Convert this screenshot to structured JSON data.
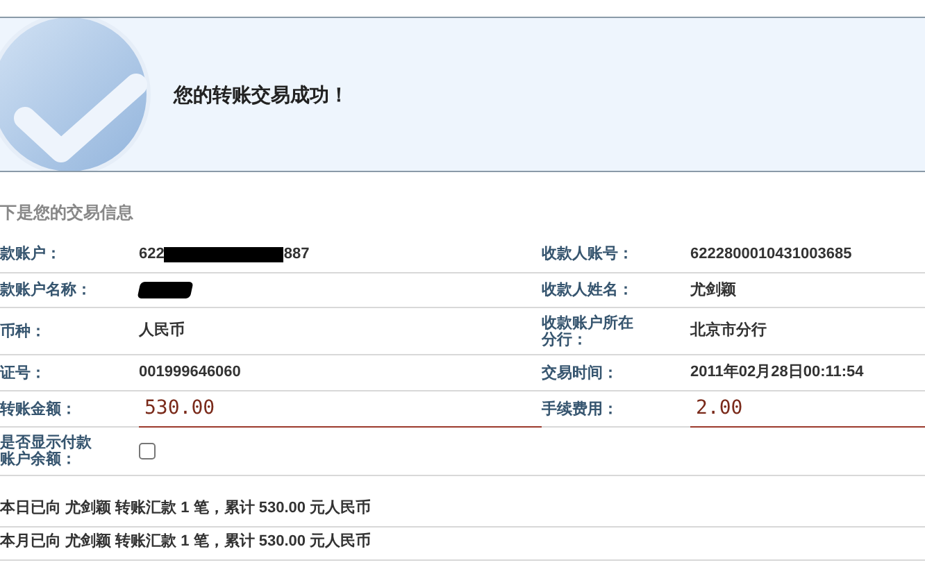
{
  "banner": {
    "title": "您的转账交易成功！"
  },
  "section_title": "下是您的交易信息",
  "rows": [
    {
      "left": {
        "label": "款账户：",
        "kind": "masked",
        "prefix": "622",
        "suffix": "887"
      },
      "right": {
        "label": "收款人账号：",
        "kind": "text",
        "value": "6222800010431003685"
      }
    },
    {
      "left": {
        "label": "款账户名称：",
        "kind": "redacted"
      },
      "right": {
        "label": "收款人姓名：",
        "kind": "text",
        "value": "尤剑颖"
      }
    },
    {
      "left": {
        "label": "币种：",
        "kind": "text",
        "value": "人民币"
      },
      "right": {
        "label": "收款账户所在分行：",
        "kind": "text",
        "value": "北京市分行"
      }
    },
    {
      "left": {
        "label": "证号：",
        "kind": "text",
        "value": "001999646060"
      },
      "right": {
        "label": "交易时间：",
        "kind": "text",
        "value": "2011年02月28日00:11:54"
      }
    },
    {
      "left": {
        "label": "转账金额：",
        "kind": "amount",
        "value": "530.00"
      },
      "right": {
        "label": "手续费用：",
        "kind": "amount",
        "value": "2.00"
      }
    },
    {
      "left": {
        "label": "是否显示付款账户余额：",
        "kind": "checkbox",
        "checked": false
      }
    }
  ],
  "summary": [
    "本日已向 尤剑颖 转账汇款 1 笔，累计 530.00 元人民币",
    "本月已向 尤剑颖 转账汇款 1 笔，累计 530.00 元人民币"
  ]
}
